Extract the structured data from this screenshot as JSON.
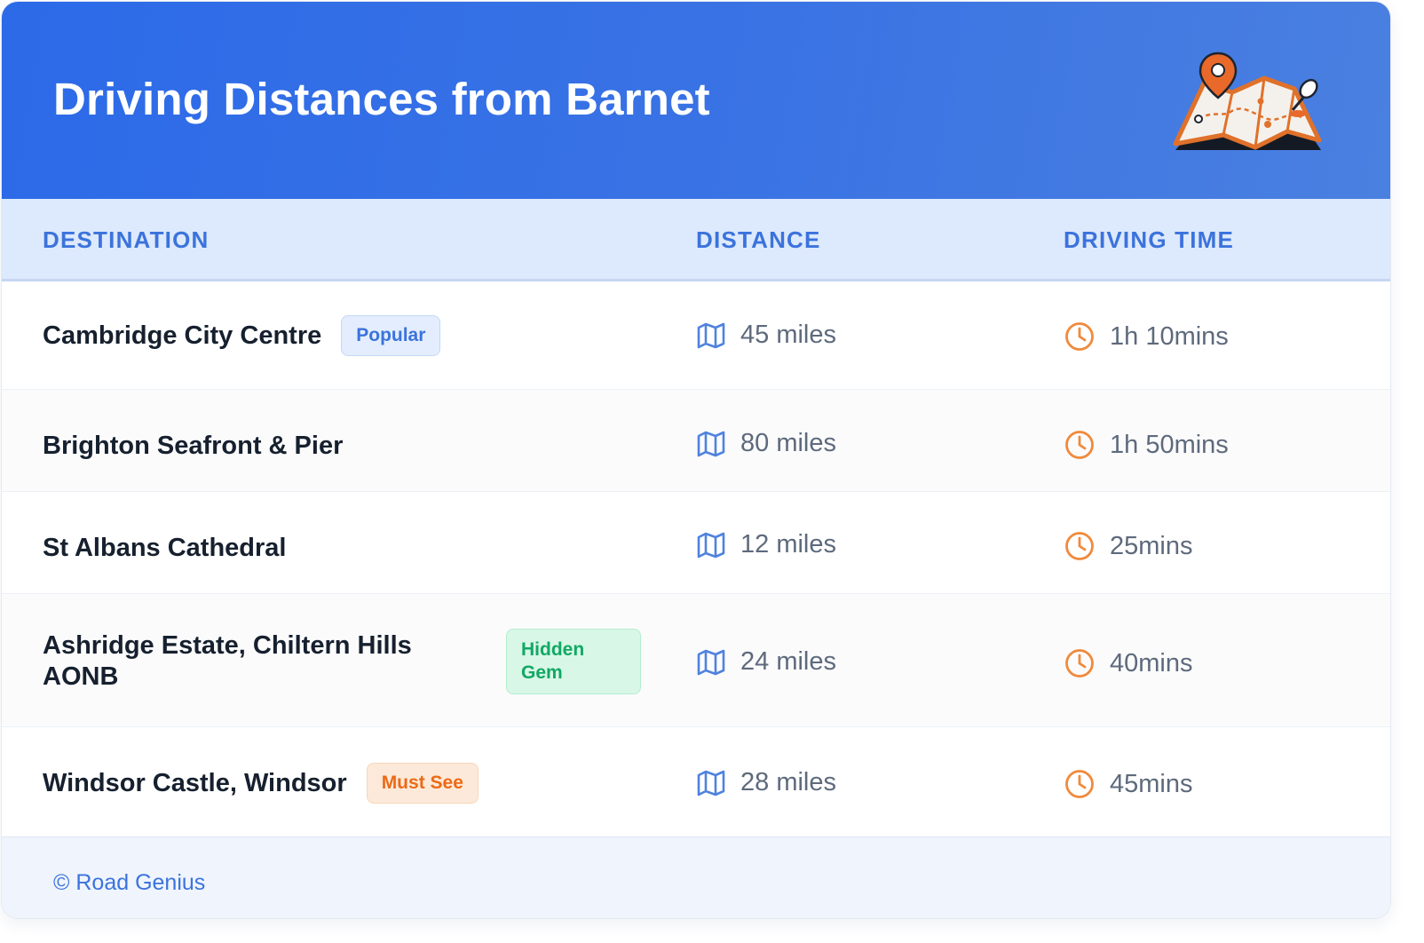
{
  "header": {
    "title": "Driving Distances from Barnet",
    "illustration_icon": "map-with-pin-icon"
  },
  "table": {
    "columns": {
      "destination": "DESTINATION",
      "distance": "DISTANCE",
      "time": "DRIVING TIME"
    },
    "rows": [
      {
        "destination": "Cambridge City Centre",
        "badge": "Popular",
        "distance": "45 miles",
        "time": "1h 10mins"
      },
      {
        "destination": "Brighton Seafront & Pier",
        "badge": "",
        "distance": "80 miles",
        "time": "1h 50mins"
      },
      {
        "destination": "St Albans Cathedral",
        "badge": "",
        "distance": "12 miles",
        "time": "25mins"
      },
      {
        "destination": "Ashridge Estate, Chiltern Hills AONB",
        "badge": "Hidden Gem",
        "distance": "24 miles",
        "time": "40mins"
      },
      {
        "destination": "Windsor Castle, Windsor",
        "badge": "Must See",
        "distance": "28 miles",
        "time": "45mins"
      }
    ],
    "distance_icon": "map-icon",
    "time_icon": "clock-icon"
  },
  "footer": {
    "credit": "© Road Genius"
  },
  "colors": {
    "header_gradient_start": "#2c6ae8",
    "header_gradient_end": "#4a80e0",
    "accent_blue": "#3b73dc",
    "accent_orange": "#f08a3c",
    "badge_green": "#12a864"
  }
}
